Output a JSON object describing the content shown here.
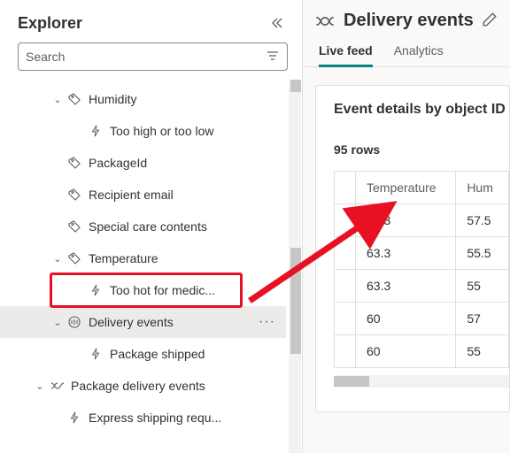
{
  "sidebar": {
    "title": "Explorer",
    "search_placeholder": "Search",
    "items": [
      {
        "label": "Humidity",
        "chev": true
      },
      {
        "label": "Too high or too low"
      },
      {
        "label": "PackageId"
      },
      {
        "label": "Recipient email"
      },
      {
        "label": "Special care contents"
      },
      {
        "label": "Temperature",
        "chev": true
      },
      {
        "label": "Too hot for medic..."
      },
      {
        "label": "Delivery events",
        "chev": true,
        "selected": true
      },
      {
        "label": "Package shipped"
      },
      {
        "label": "Package delivery events",
        "chev": true
      },
      {
        "label": "Express shipping requ..."
      }
    ]
  },
  "main": {
    "title": "Delivery events",
    "tabs": {
      "live": "Live feed",
      "analytics": "Analytics"
    },
    "card": {
      "title": "Event details by object ID",
      "rowcount": "95 rows",
      "columns": {
        "c1": "Temperature",
        "c2": "Hum"
      },
      "rows": [
        {
          "t": "63.3",
          "h": "57.5"
        },
        {
          "t": "63.3",
          "h": "55.5"
        },
        {
          "t": "63.3",
          "h": "55"
        },
        {
          "t": "60",
          "h": "57"
        },
        {
          "t": "60",
          "h": "55"
        }
      ]
    }
  }
}
